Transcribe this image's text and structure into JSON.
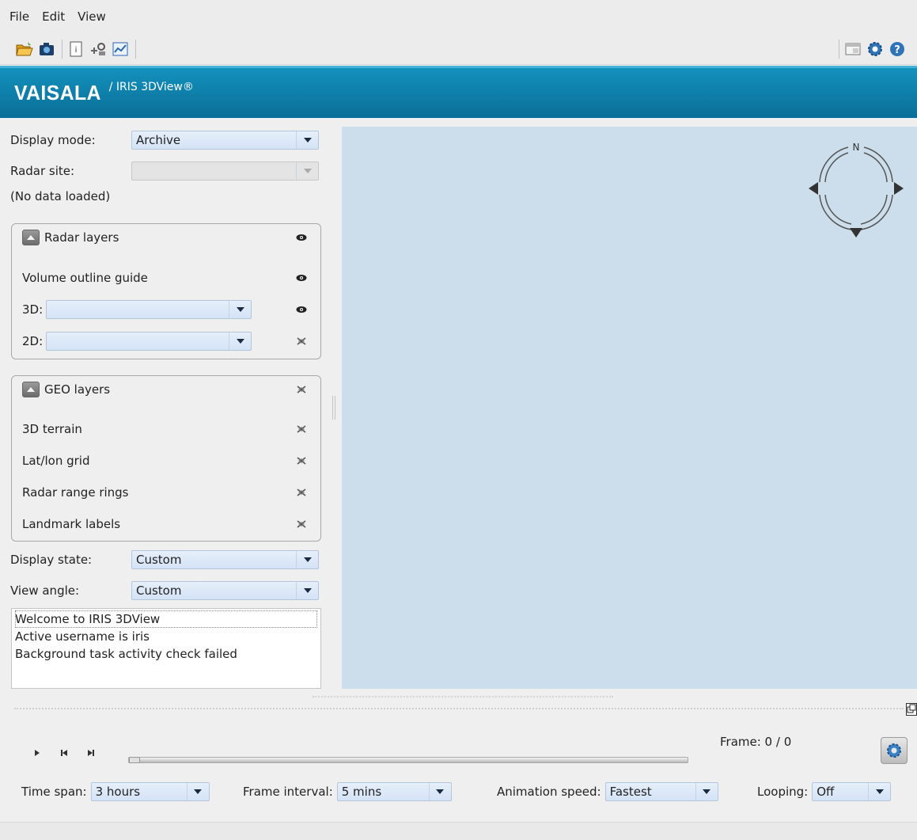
{
  "menu": {
    "file": "File",
    "edit": "Edit",
    "view": "View"
  },
  "banner": {
    "brand": "VAISALA",
    "product": "/ IRIS 3DView®"
  },
  "controls": {
    "display_mode_label": "Display mode:",
    "display_mode_value": "Archive",
    "radar_site_label": "Radar site:",
    "radar_site_value": "",
    "no_data": "(No data loaded)",
    "display_state_label": "Display state:",
    "display_state_value": "Custom",
    "view_angle_label": "View angle:",
    "view_angle_value": "Custom"
  },
  "radar_layers": {
    "title": "Radar layers",
    "volume_outline": "Volume outline guide",
    "label_3d": "3D:",
    "label_2d": "2D:"
  },
  "geo_layers": {
    "title": "GEO layers",
    "items": [
      "3D terrain",
      "Lat/lon grid",
      "Radar range rings",
      "Landmark labels"
    ]
  },
  "log": {
    "lines": [
      "Welcome to IRIS 3DView",
      "Active username is iris",
      "Background task activity check failed"
    ]
  },
  "compass": {
    "north": "N"
  },
  "animation": {
    "frame_text": "Frame: 0 / 0",
    "frame_progress": 0,
    "time_span_label": "Time span:",
    "time_span_value": "3 hours",
    "frame_interval_label": "Frame interval:",
    "frame_interval_value": "5 mins",
    "speed_label": "Animation speed:",
    "speed_value": "Fastest",
    "looping_label": "Looping:",
    "looping_value": "Off"
  },
  "colors": {
    "banner": "#0a7fab",
    "viewport": "#ccdeec",
    "combo": "#d4e3f6"
  }
}
